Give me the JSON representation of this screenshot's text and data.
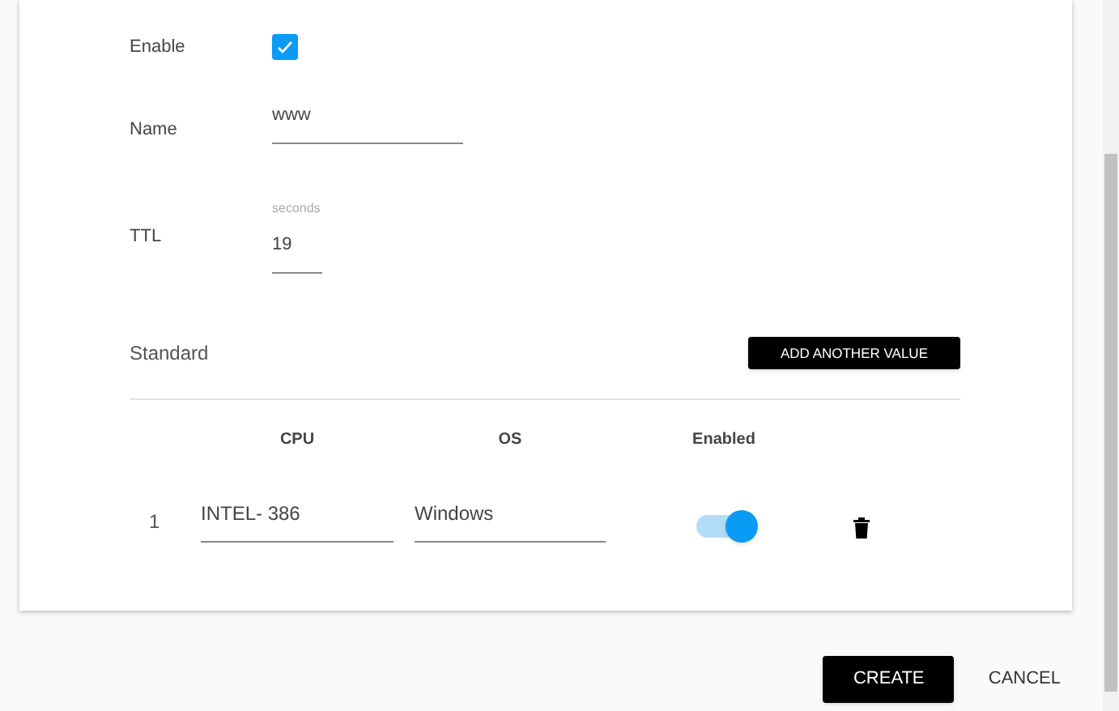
{
  "form": {
    "enable": {
      "label": "Enable",
      "checked": true
    },
    "name": {
      "label": "Name",
      "value": "www"
    },
    "ttl": {
      "label": "TTL",
      "hint": "seconds",
      "value": "19"
    }
  },
  "standard": {
    "title": "Standard",
    "add_button": "ADD ANOTHER VALUE",
    "columns": [
      "CPU",
      "OS",
      "Enabled"
    ],
    "rows": [
      {
        "index": "1",
        "cpu": "INTEL- 386",
        "os": "Windows",
        "enabled": true
      }
    ]
  },
  "buttons": {
    "create": "CREATE",
    "cancel": "CANCEL"
  }
}
